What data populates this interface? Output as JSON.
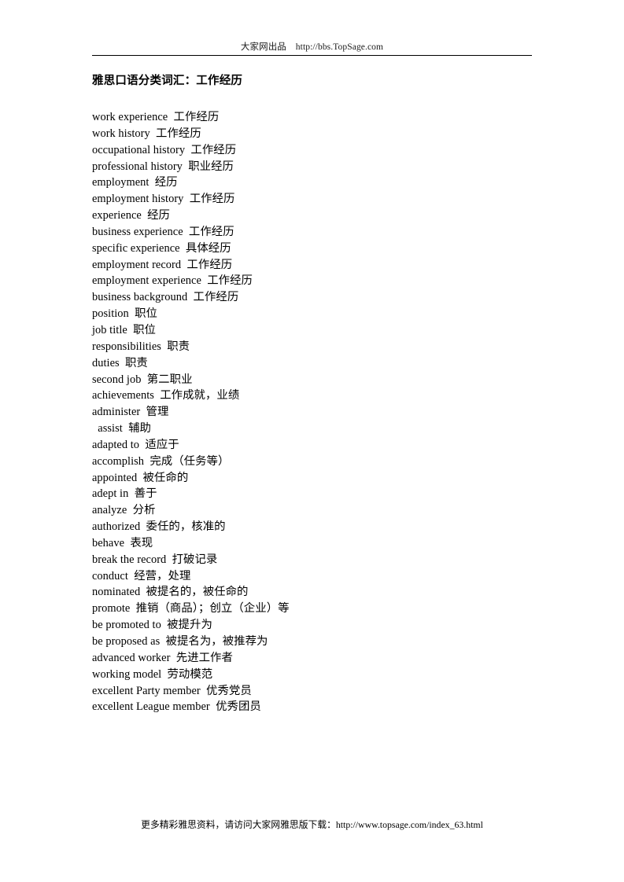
{
  "header": {
    "text": "大家网出品    http://bbs.TopSage.com"
  },
  "title": "雅思口语分类词汇：工作经历",
  "vocabulary": {
    "lines": [
      "work experience  工作经历",
      "work history  工作经历",
      "occupational history  工作经历",
      "professional history  职业经历",
      "employment  经历",
      "employment history  工作经历",
      "experience  经历",
      "business experience  工作经历",
      "specific experience  具体经历",
      "employment record  工作经历",
      "employment experience  工作经历",
      "business background  工作经历",
      "position  职位",
      "job title  职位",
      "responsibilities  职责",
      "duties  职责",
      "second job  第二职业",
      "achievements  工作成就，业绩",
      "administer  管理",
      "  assist  辅助",
      "adapted to  适应于",
      "accomplish  完成（任务等）",
      "appointed  被任命的",
      "adept in  善于",
      "analyze  分析",
      "authorized  委任的，核准的",
      "behave  表现",
      "break the record  打破记录",
      "conduct  经营，处理",
      "nominated  被提名的，被任命的",
      "promote  推销（商品）；创立（企业）等",
      "be promoted to  被提升为",
      "be proposed as  被提名为，被推荐为",
      "advanced worker  先进工作者",
      "working model  劳动模范",
      "excellent Party member  优秀党员",
      "excellent League member  优秀团员"
    ]
  },
  "footer": {
    "text": "更多精彩雅思资料，请访问大家网雅思版下载：http://www.topsage.com/index_63.html"
  }
}
